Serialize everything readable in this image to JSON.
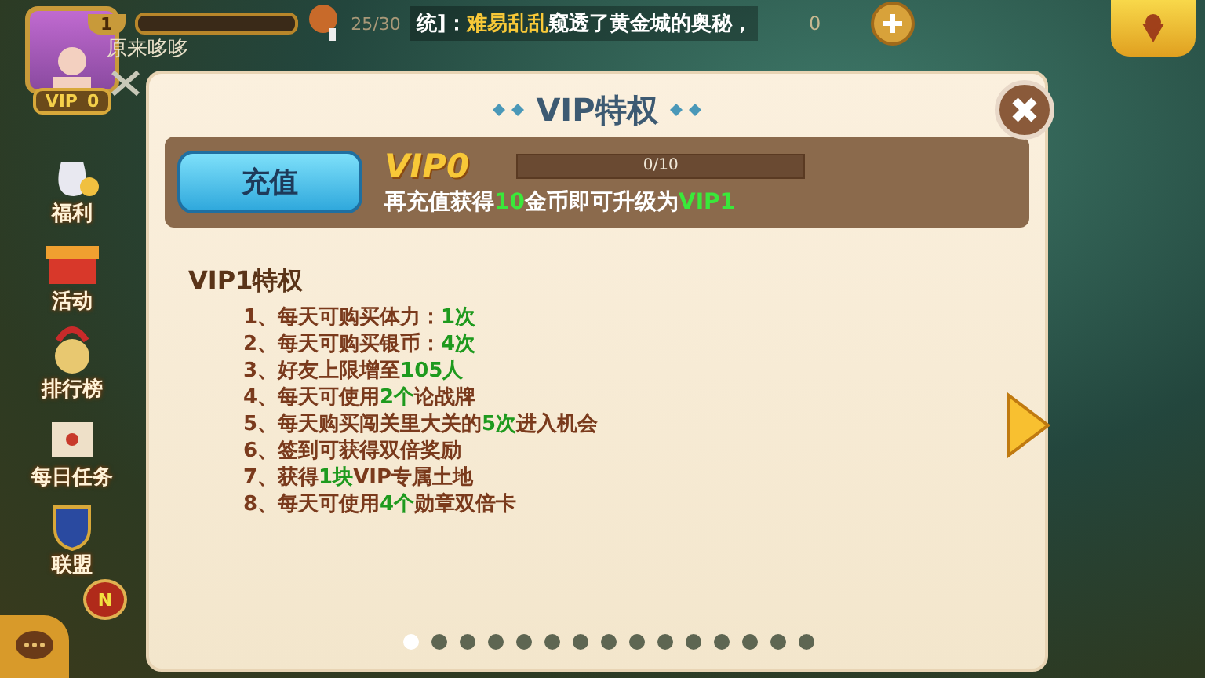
{
  "player": {
    "level": "1",
    "exp": {
      "level": 0.0
    },
    "name": "原来哆哆",
    "vip_label": "VIP",
    "vip_value": "0"
  },
  "top_bar": {
    "stamina": "25/30",
    "broadcast": [
      {
        "text": "统]：",
        "highlight": false
      },
      {
        "text": "难易乱乱",
        "highlight": true
      },
      {
        "text": "窥透了黄金城的奥秘，",
        "highlight": false
      }
    ],
    "coins": "0"
  },
  "side_menu": [
    {
      "label": "福利",
      "kind": "bag"
    },
    {
      "label": "活动",
      "kind": "gift"
    },
    {
      "label": "排行榜",
      "kind": "medal"
    },
    {
      "label": "每日任务",
      "kind": "scroll"
    },
    {
      "label": "联盟",
      "kind": "shield",
      "badge": "N"
    }
  ],
  "dialog": {
    "title": "VIP特权",
    "recharge_button": "充值",
    "vip_level": "VIP0",
    "progress": {
      "reading": "0/10",
      "level": 0.0
    },
    "upgrade_hint": [
      {
        "text": "再充值获得",
        "highlight": false
      },
      {
        "text": "10",
        "highlight": true
      },
      {
        "text": "金币即可升级为",
        "highlight": false
      },
      {
        "text": "VIP1",
        "highlight": true
      }
    ],
    "section_title": "VIP1特权",
    "privileges": [
      [
        {
          "text": "1、每天可购买体力：",
          "highlight": false
        },
        {
          "text": "1次",
          "highlight": true
        }
      ],
      [
        {
          "text": "2、每天可购买银币：",
          "highlight": false
        },
        {
          "text": "4次",
          "highlight": true
        }
      ],
      [
        {
          "text": "3、好友上限增至",
          "highlight": false
        },
        {
          "text": "105人",
          "highlight": true
        }
      ],
      [
        {
          "text": "4、每天可使用",
          "highlight": false
        },
        {
          "text": "2个",
          "highlight": true
        },
        {
          "text": "论战牌",
          "highlight": false
        }
      ],
      [
        {
          "text": "5、每天购买闯关里大关的",
          "highlight": false
        },
        {
          "text": "5次",
          "highlight": true
        },
        {
          "text": "进入机会",
          "highlight": false
        }
      ],
      [
        {
          "text": "6、签到可获得双倍奖励",
          "highlight": false
        }
      ],
      [
        {
          "text": "7、获得",
          "highlight": false
        },
        {
          "text": "1块",
          "highlight": true
        },
        {
          "text": "VIP专属土地",
          "highlight": false
        }
      ],
      [
        {
          "text": "8、每天可使用",
          "highlight": false
        },
        {
          "text": "4个",
          "highlight": true
        },
        {
          "text": "勋章双倍卡",
          "highlight": false
        }
      ]
    ],
    "pages": [
      {
        "selected": true
      },
      {
        "selected": false
      },
      {
        "selected": false
      },
      {
        "selected": false
      },
      {
        "selected": false
      },
      {
        "selected": false
      },
      {
        "selected": false
      },
      {
        "selected": false
      },
      {
        "selected": false
      },
      {
        "selected": false
      },
      {
        "selected": false
      },
      {
        "selected": false
      },
      {
        "selected": false
      },
      {
        "selected": false
      },
      {
        "selected": false
      }
    ]
  }
}
